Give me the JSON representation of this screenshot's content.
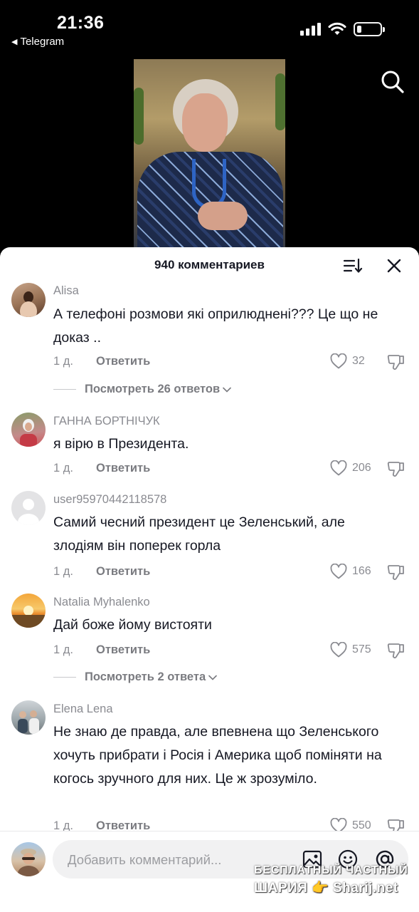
{
  "status_bar": {
    "time": "21:36",
    "back_app": "Telegram"
  },
  "header": {
    "title": "940 комментариев"
  },
  "comments": [
    {
      "user": "Alisa",
      "text": "А телефоні розмови які оприлюднені??? Це що не доказ ..",
      "age": "1 д.",
      "reply": "Ответить",
      "likes": "32",
      "replies": "Посмотреть 26 ответов"
    },
    {
      "user": "ГАННА БОРТНІЧУК",
      "text": "я вірю в Президента.",
      "age": "1 д.",
      "reply": "Ответить",
      "likes": "206"
    },
    {
      "user": "user95970442118578",
      "text": "Самий чесний президент це Зеленський, але злодіям він поперек горла",
      "age": "1 д.",
      "reply": "Ответить",
      "likes": "166"
    },
    {
      "user": "Natalia Myhalenko",
      "text": "Дай боже йому вистояти",
      "age": "1 д.",
      "reply": "Ответить",
      "likes": "575",
      "replies": "Посмотреть 2 ответа"
    },
    {
      "user": "Elena Lena",
      "text": "Не знаю де правда, але впевнена що Зеленського хочуть прибрати і Росія і Америка щоб поміняти на когось зручного для них. Це ж зрозуміло.",
      "age": "1 д.",
      "reply": "Ответить",
      "likes": "550"
    }
  ],
  "input": {
    "placeholder": "Добавить комментарий..."
  },
  "watermark": {
    "line1": "БЕСПЛАТНЫЙ ЧАСТНЫЙ",
    "line2": "ШАРИЯ 👉 Sharij.net"
  }
}
